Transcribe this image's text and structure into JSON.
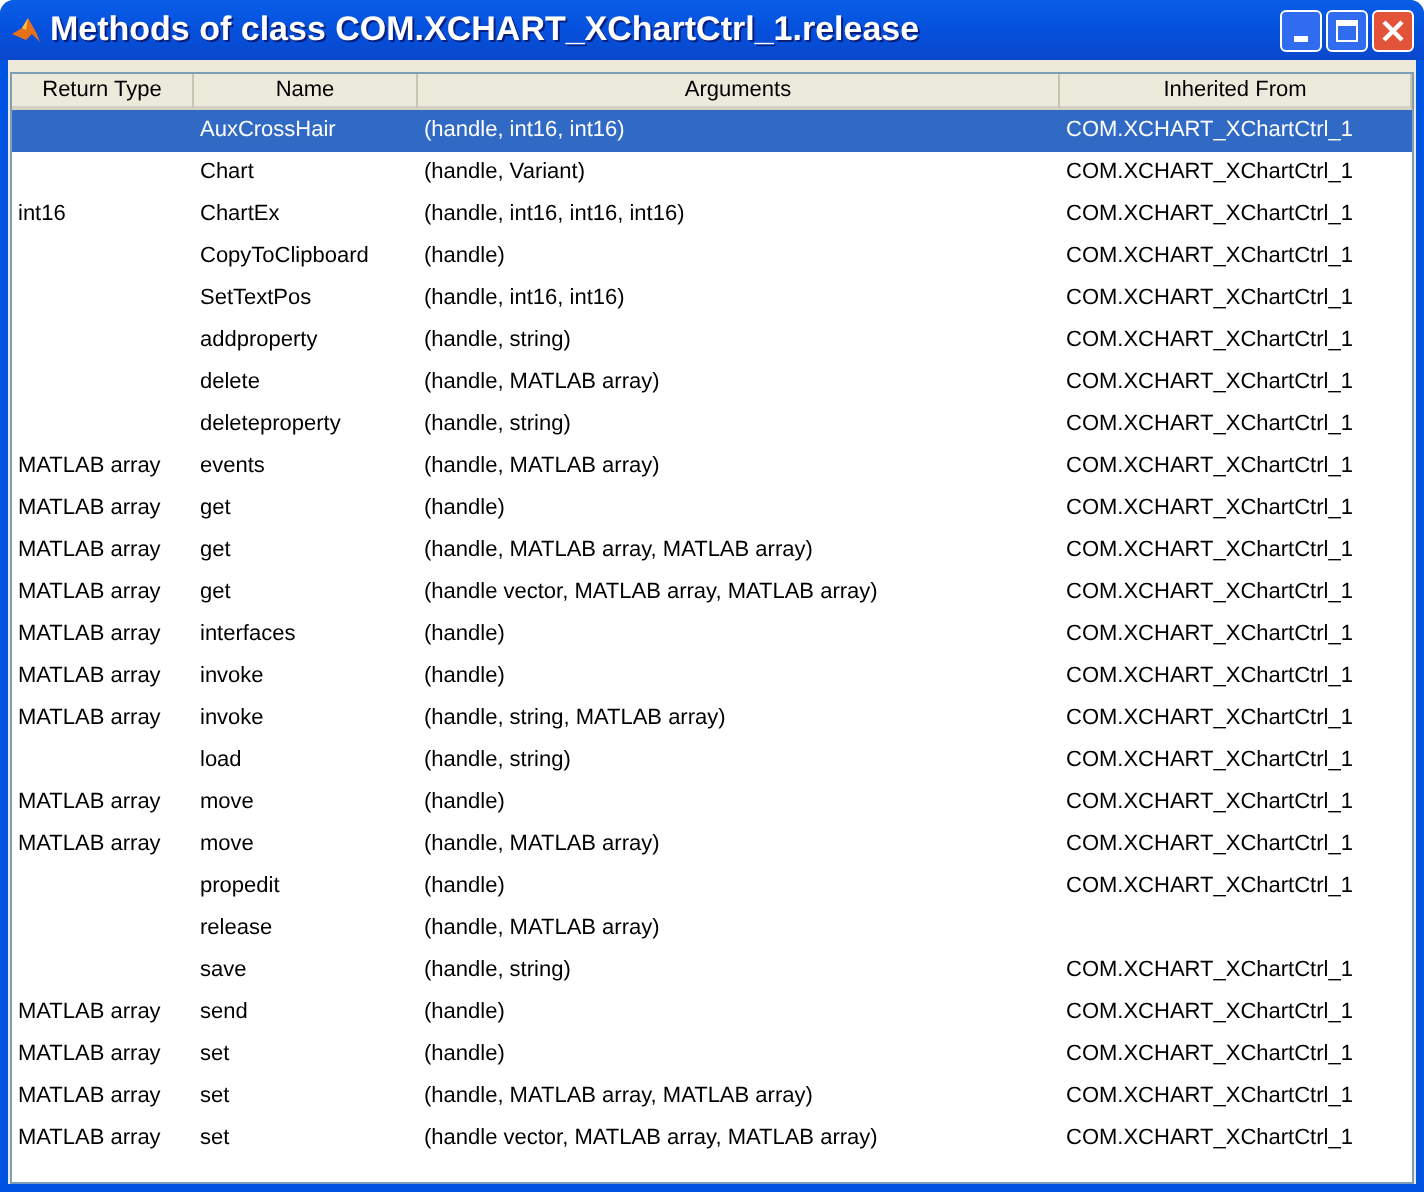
{
  "window": {
    "title": "Methods of class COM.XCHART_XChartCtrl_1.release"
  },
  "table": {
    "columns": [
      "Return Type",
      "Name",
      "Arguments",
      "Inherited From"
    ],
    "rows": [
      {
        "name": "AuxCrossHair",
        "arguments": "(handle, int16, int16)",
        "inherited_from": "COM.XCHART_XChartCtrl_1",
        "selected": true
      },
      {
        "name": "Chart",
        "arguments": "(handle, Variant)",
        "inherited_from": "COM.XCHART_XChartCtrl_1",
        "selected": false
      },
      {
        "return_type": "int16",
        "name": "ChartEx",
        "arguments": "(handle, int16, int16, int16)",
        "inherited_from": "COM.XCHART_XChartCtrl_1",
        "selected": false
      },
      {
        "name": "CopyToClipboard",
        "arguments": "(handle)",
        "inherited_from": "COM.XCHART_XChartCtrl_1",
        "selected": false
      },
      {
        "name": "SetTextPos",
        "arguments": "(handle, int16, int16)",
        "inherited_from": "COM.XCHART_XChartCtrl_1",
        "selected": false
      },
      {
        "name": "addproperty",
        "arguments": "(handle, string)",
        "inherited_from": "COM.XCHART_XChartCtrl_1",
        "selected": false
      },
      {
        "name": "delete",
        "arguments": "(handle, MATLAB array)",
        "inherited_from": "COM.XCHART_XChartCtrl_1",
        "selected": false
      },
      {
        "name": "deleteproperty",
        "arguments": "(handle, string)",
        "inherited_from": "COM.XCHART_XChartCtrl_1",
        "selected": false
      },
      {
        "return_type": "MATLAB array",
        "name": "events",
        "arguments": "(handle, MATLAB array)",
        "inherited_from": "COM.XCHART_XChartCtrl_1",
        "selected": false
      },
      {
        "return_type": "MATLAB array",
        "name": "get",
        "arguments": "(handle)",
        "inherited_from": "COM.XCHART_XChartCtrl_1",
        "selected": false
      },
      {
        "return_type": "MATLAB array",
        "name": "get",
        "arguments": "(handle, MATLAB array, MATLAB array)",
        "inherited_from": "COM.XCHART_XChartCtrl_1",
        "selected": false
      },
      {
        "return_type": "MATLAB array",
        "name": "get",
        "arguments": "(handle vector, MATLAB array, MATLAB array)",
        "inherited_from": "COM.XCHART_XChartCtrl_1",
        "selected": false
      },
      {
        "return_type": "MATLAB array",
        "name": "interfaces",
        "arguments": "(handle)",
        "inherited_from": "COM.XCHART_XChartCtrl_1",
        "selected": false
      },
      {
        "return_type": "MATLAB array",
        "name": "invoke",
        "arguments": "(handle)",
        "inherited_from": "COM.XCHART_XChartCtrl_1",
        "selected": false
      },
      {
        "return_type": "MATLAB array",
        "name": "invoke",
        "arguments": "(handle, string, MATLAB array)",
        "inherited_from": "COM.XCHART_XChartCtrl_1",
        "selected": false
      },
      {
        "name": "load",
        "arguments": "(handle, string)",
        "inherited_from": "COM.XCHART_XChartCtrl_1",
        "selected": false
      },
      {
        "return_type": "MATLAB array",
        "name": "move",
        "arguments": "(handle)",
        "inherited_from": "COM.XCHART_XChartCtrl_1",
        "selected": false
      },
      {
        "return_type": "MATLAB array",
        "name": "move",
        "arguments": "(handle, MATLAB array)",
        "inherited_from": "COM.XCHART_XChartCtrl_1",
        "selected": false
      },
      {
        "name": "propedit",
        "arguments": "(handle)",
        "inherited_from": "COM.XCHART_XChartCtrl_1",
        "selected": false
      },
      {
        "name": "release",
        "arguments": "(handle, MATLAB array)",
        "selected": false
      },
      {
        "name": "save",
        "arguments": "(handle, string)",
        "inherited_from": "COM.XCHART_XChartCtrl_1",
        "selected": false
      },
      {
        "return_type": "MATLAB array",
        "name": "send",
        "arguments": "(handle)",
        "inherited_from": "COM.XCHART_XChartCtrl_1",
        "selected": false
      },
      {
        "return_type": "MATLAB array",
        "name": "set",
        "arguments": "(handle)",
        "inherited_from": "COM.XCHART_XChartCtrl_1",
        "selected": false
      },
      {
        "return_type": "MATLAB array",
        "name": "set",
        "arguments": "(handle, MATLAB array, MATLAB array)",
        "inherited_from": "COM.XCHART_XChartCtrl_1",
        "selected": false
      },
      {
        "return_type": "MATLAB array",
        "name": "set",
        "arguments": "(handle vector, MATLAB array, MATLAB array)",
        "inherited_from": "COM.XCHART_XChartCtrl_1",
        "selected": false
      }
    ]
  }
}
